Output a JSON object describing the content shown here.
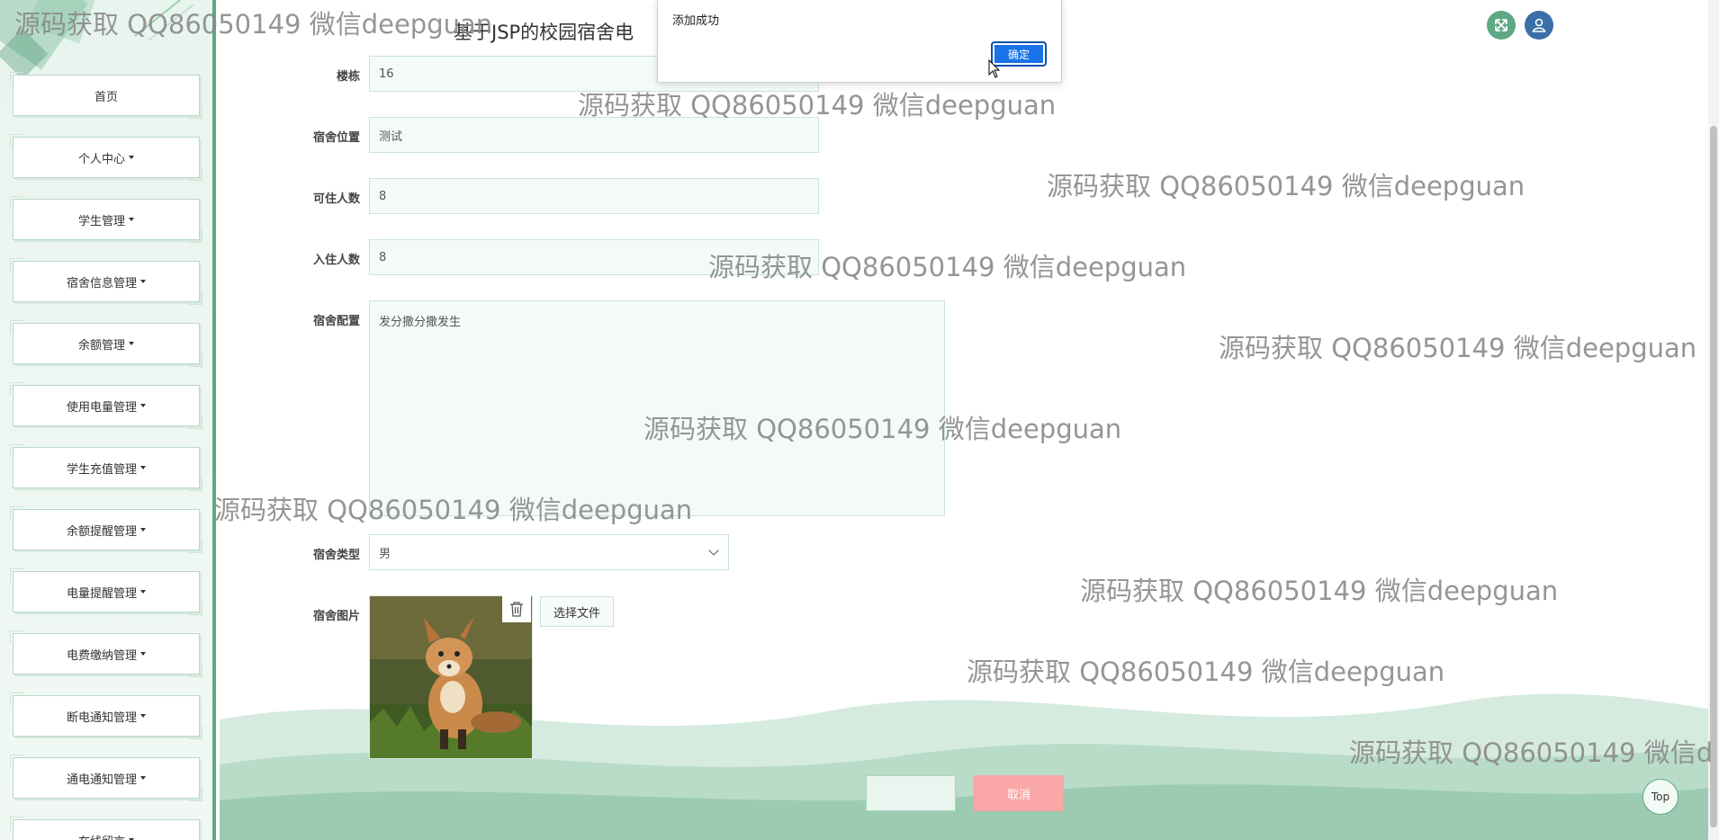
{
  "header": {
    "site_title": "基于JSP的校园宿舍电"
  },
  "sidebar": {
    "items": [
      {
        "label": "首页",
        "dropdown": false
      },
      {
        "label": "个人中心",
        "dropdown": true
      },
      {
        "label": "学生管理",
        "dropdown": true
      },
      {
        "label": "宿舍信息管理",
        "dropdown": true
      },
      {
        "label": "余额管理",
        "dropdown": true
      },
      {
        "label": "使用电量管理",
        "dropdown": true
      },
      {
        "label": "学生充值管理",
        "dropdown": true
      },
      {
        "label": "余额提醒管理",
        "dropdown": true
      },
      {
        "label": "电量提醒管理",
        "dropdown": true
      },
      {
        "label": "电费缴纳管理",
        "dropdown": true
      },
      {
        "label": "断电通知管理",
        "dropdown": true
      },
      {
        "label": "通电通知管理",
        "dropdown": true
      },
      {
        "label": "在线留言",
        "dropdown": true
      }
    ]
  },
  "form": {
    "building": {
      "label": "楼栋",
      "value": "16"
    },
    "location": {
      "label": "宿舍位置",
      "value": "测试"
    },
    "capacity": {
      "label": "可住人数",
      "value": "8"
    },
    "occupied": {
      "label": "入住人数",
      "value": "8"
    },
    "config": {
      "label": "宿舍配置",
      "value": "发分撒分撒发生"
    },
    "type": {
      "label": "宿舍类型",
      "value": "男"
    },
    "image": {
      "label": "宿舍图片",
      "choose_file": "选择文件"
    }
  },
  "actions": {
    "save": "",
    "cancel": "取消"
  },
  "dialog": {
    "message": "添加成功",
    "ok": "确定"
  },
  "top_button": "Top",
  "watermark": "源码获取 QQ86050149 微信deepguan",
  "watermark_cut": "源码获取 QQ86050149 微信d",
  "icons": {
    "fullscreen": "expand-arrows-icon",
    "user": "user-icon",
    "trash": "trash-icon"
  },
  "colors": {
    "accent_green": "#5ea884",
    "dialog_ok_blue": "#1a73e8",
    "cancel_red": "#f9a7a7"
  }
}
